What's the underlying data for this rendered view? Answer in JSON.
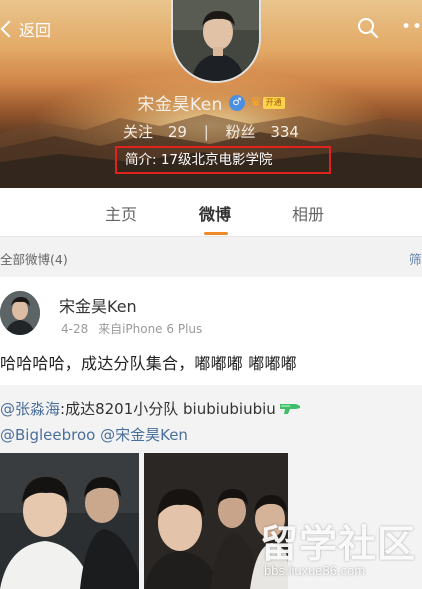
{
  "header": {
    "back_label": "返回",
    "profile_name": "宋金昊Ken",
    "gender_symbol": "♂",
    "vip_label": "开通",
    "stats": {
      "follow_label": "关注",
      "follow_count": "29",
      "separator": "|",
      "fans_label": "粉丝",
      "fans_count": "334"
    },
    "intro": "简介: 17级北京电影学院"
  },
  "tabs": [
    {
      "label": "主页",
      "active": false
    },
    {
      "label": "微博",
      "active": true
    },
    {
      "label": "相册",
      "active": false
    }
  ],
  "filter_bar": {
    "label": "全部微博(4)",
    "filter_label": "筛"
  },
  "post": {
    "author": "宋金昊Ken",
    "date": "4-28",
    "source": "来自iPhone 6 Plus",
    "text": "哈哈哈哈，成达分队集合，嘟嘟嘟 嘟嘟嘟",
    "repost": {
      "mention1": "@张淼海",
      "text1": ":成达8201小分队 biubiubiubiu",
      "mention2": "@Bigleebroo",
      "mention3": "@宋金昊Ken"
    }
  },
  "watermark": {
    "text": "留学社区",
    "url": "bbs.liuxue86.com"
  },
  "colors": {
    "accent": "#f08a26",
    "highlight_box": "#e2221d",
    "link": "#4a6f9c"
  },
  "icons": [
    "back-chevron-icon",
    "search-icon",
    "more-icon",
    "gender-male-icon",
    "vip-crown-icon",
    "water-gun-emoji-icon"
  ]
}
